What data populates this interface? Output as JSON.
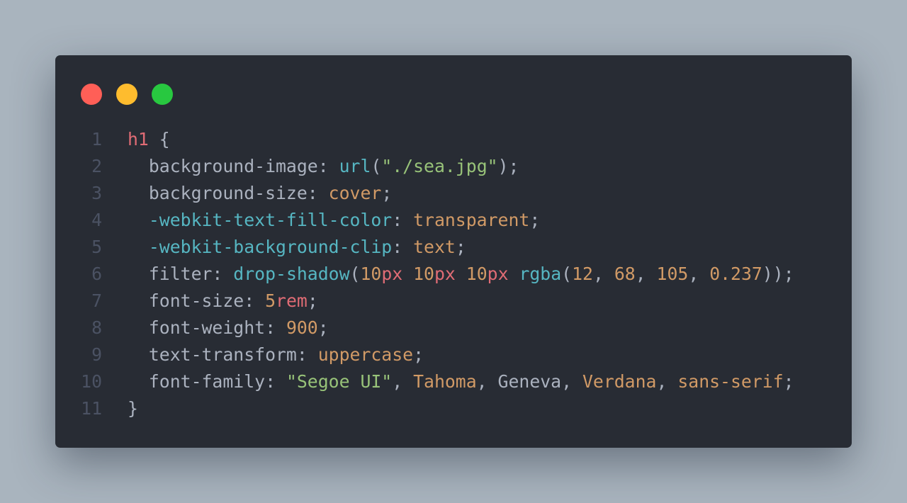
{
  "colors": {
    "background": "#a9b4be",
    "window": "#282c34",
    "line_number": "#4b5263",
    "plain": "#abb2bf",
    "selector": "#e06c75",
    "property_vendor": "#56b6c2",
    "string": "#98c379",
    "value": "#d19a66"
  },
  "window_controls": [
    {
      "name": "close-dot",
      "color": "#ff5f57"
    },
    {
      "name": "minimize-dot",
      "color": "#febc2e"
    },
    {
      "name": "maximize-dot",
      "color": "#28c840"
    }
  ],
  "code": {
    "language": "css",
    "lines": [
      {
        "num": "1",
        "tokens": [
          {
            "t": "h1",
            "c": "red"
          },
          {
            "t": " {",
            "c": "plain"
          }
        ]
      },
      {
        "num": "2",
        "tokens": [
          {
            "t": "  background-image: ",
            "c": "plain"
          },
          {
            "t": "url",
            "c": "cyan"
          },
          {
            "t": "(",
            "c": "plain"
          },
          {
            "t": "\"./sea.jpg\"",
            "c": "green"
          },
          {
            "t": ");",
            "c": "plain"
          }
        ]
      },
      {
        "num": "3",
        "tokens": [
          {
            "t": "  background-size: ",
            "c": "plain"
          },
          {
            "t": "cover",
            "c": "orange"
          },
          {
            "t": ";",
            "c": "plain"
          }
        ]
      },
      {
        "num": "4",
        "tokens": [
          {
            "t": "  ",
            "c": "plain"
          },
          {
            "t": "-webkit-text-fill-color",
            "c": "cyan"
          },
          {
            "t": ": ",
            "c": "plain"
          },
          {
            "t": "transparent",
            "c": "orange"
          },
          {
            "t": ";",
            "c": "plain"
          }
        ]
      },
      {
        "num": "5",
        "tokens": [
          {
            "t": "  ",
            "c": "plain"
          },
          {
            "t": "-webkit-background-clip",
            "c": "cyan"
          },
          {
            "t": ": ",
            "c": "plain"
          },
          {
            "t": "text",
            "c": "orange"
          },
          {
            "t": ";",
            "c": "plain"
          }
        ]
      },
      {
        "num": "6",
        "tokens": [
          {
            "t": "  filter: ",
            "c": "plain"
          },
          {
            "t": "drop-shadow",
            "c": "cyan"
          },
          {
            "t": "(",
            "c": "plain"
          },
          {
            "t": "10",
            "c": "orange"
          },
          {
            "t": "px",
            "c": "red"
          },
          {
            "t": " ",
            "c": "plain"
          },
          {
            "t": "10",
            "c": "orange"
          },
          {
            "t": "px",
            "c": "red"
          },
          {
            "t": " ",
            "c": "plain"
          },
          {
            "t": "10",
            "c": "orange"
          },
          {
            "t": "px",
            "c": "red"
          },
          {
            "t": " ",
            "c": "plain"
          },
          {
            "t": "rgba",
            "c": "cyan"
          },
          {
            "t": "(",
            "c": "plain"
          },
          {
            "t": "12",
            "c": "orange"
          },
          {
            "t": ", ",
            "c": "plain"
          },
          {
            "t": "68",
            "c": "orange"
          },
          {
            "t": ", ",
            "c": "plain"
          },
          {
            "t": "105",
            "c": "orange"
          },
          {
            "t": ", ",
            "c": "plain"
          },
          {
            "t": "0.237",
            "c": "orange"
          },
          {
            "t": "));",
            "c": "plain"
          }
        ]
      },
      {
        "num": "7",
        "tokens": [
          {
            "t": "  font-size: ",
            "c": "plain"
          },
          {
            "t": "5",
            "c": "orange"
          },
          {
            "t": "rem",
            "c": "red"
          },
          {
            "t": ";",
            "c": "plain"
          }
        ]
      },
      {
        "num": "8",
        "tokens": [
          {
            "t": "  font-weight: ",
            "c": "plain"
          },
          {
            "t": "900",
            "c": "orange"
          },
          {
            "t": ";",
            "c": "plain"
          }
        ]
      },
      {
        "num": "9",
        "tokens": [
          {
            "t": "  text-transform: ",
            "c": "plain"
          },
          {
            "t": "uppercase",
            "c": "orange"
          },
          {
            "t": ";",
            "c": "plain"
          }
        ]
      },
      {
        "num": "10",
        "tokens": [
          {
            "t": "  font-family: ",
            "c": "plain"
          },
          {
            "t": "\"Segoe UI\"",
            "c": "green"
          },
          {
            "t": ", ",
            "c": "plain"
          },
          {
            "t": "Tahoma",
            "c": "orange"
          },
          {
            "t": ", Geneva, ",
            "c": "plain"
          },
          {
            "t": "Verdana",
            "c": "orange"
          },
          {
            "t": ", ",
            "c": "plain"
          },
          {
            "t": "sans-serif",
            "c": "orange"
          },
          {
            "t": ";",
            "c": "plain"
          }
        ]
      },
      {
        "num": "11",
        "tokens": [
          {
            "t": "}",
            "c": "plain"
          }
        ]
      }
    ]
  }
}
